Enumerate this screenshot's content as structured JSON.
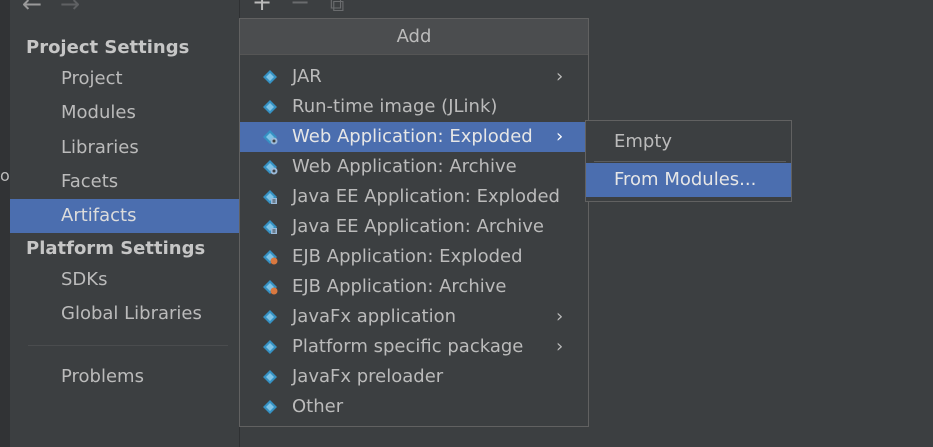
{
  "edge_glyph": "o",
  "nav": {
    "back": "←",
    "forward": "→"
  },
  "toolbar": {
    "add": "+",
    "remove": "−",
    "copy": "⧉"
  },
  "sidebar": {
    "project_settings_header": "Project Settings",
    "project_items": [
      {
        "label": "Project"
      },
      {
        "label": "Modules"
      },
      {
        "label": "Libraries"
      },
      {
        "label": "Facets"
      },
      {
        "label": "Artifacts",
        "selected": true
      }
    ],
    "platform_settings_header": "Platform Settings",
    "platform_items": [
      {
        "label": "SDKs"
      },
      {
        "label": "Global Libraries"
      }
    ],
    "problems_label": "Problems"
  },
  "add_popup": {
    "title": "Add",
    "items": [
      {
        "label": "JAR",
        "icon": "diamond-icon",
        "submenu": true
      },
      {
        "label": "Run-time image (JLink)",
        "icon": "diamond-icon"
      },
      {
        "label": "Web Application: Exploded",
        "icon": "web-diamond-icon",
        "submenu": true,
        "selected": true
      },
      {
        "label": "Web Application: Archive",
        "icon": "web-diamond-icon"
      },
      {
        "label": "Java EE Application: Exploded",
        "icon": "ee-diamond-icon"
      },
      {
        "label": "Java EE Application: Archive",
        "icon": "ee-diamond-icon"
      },
      {
        "label": "EJB Application: Exploded",
        "icon": "ejb-diamond-icon"
      },
      {
        "label": "EJB Application: Archive",
        "icon": "ejb-diamond-icon"
      },
      {
        "label": "JavaFx application",
        "icon": "diamond-icon",
        "submenu": true
      },
      {
        "label": "Platform specific package",
        "icon": "diamond-icon",
        "submenu": true
      },
      {
        "label": "JavaFx preloader",
        "icon": "diamond-icon"
      },
      {
        "label": "Other",
        "icon": "diamond-icon"
      }
    ],
    "chevron": "›"
  },
  "submenu": {
    "items": [
      {
        "label": "Empty"
      },
      {
        "label": "From Modules...",
        "selected": true
      }
    ]
  },
  "colors": {
    "background": "#3c3f41",
    "selection": "#4b6eaf",
    "icon_blue": "#3592c4",
    "badge_blue": "#9ab9d8",
    "badge_orange": "#d9783f"
  }
}
